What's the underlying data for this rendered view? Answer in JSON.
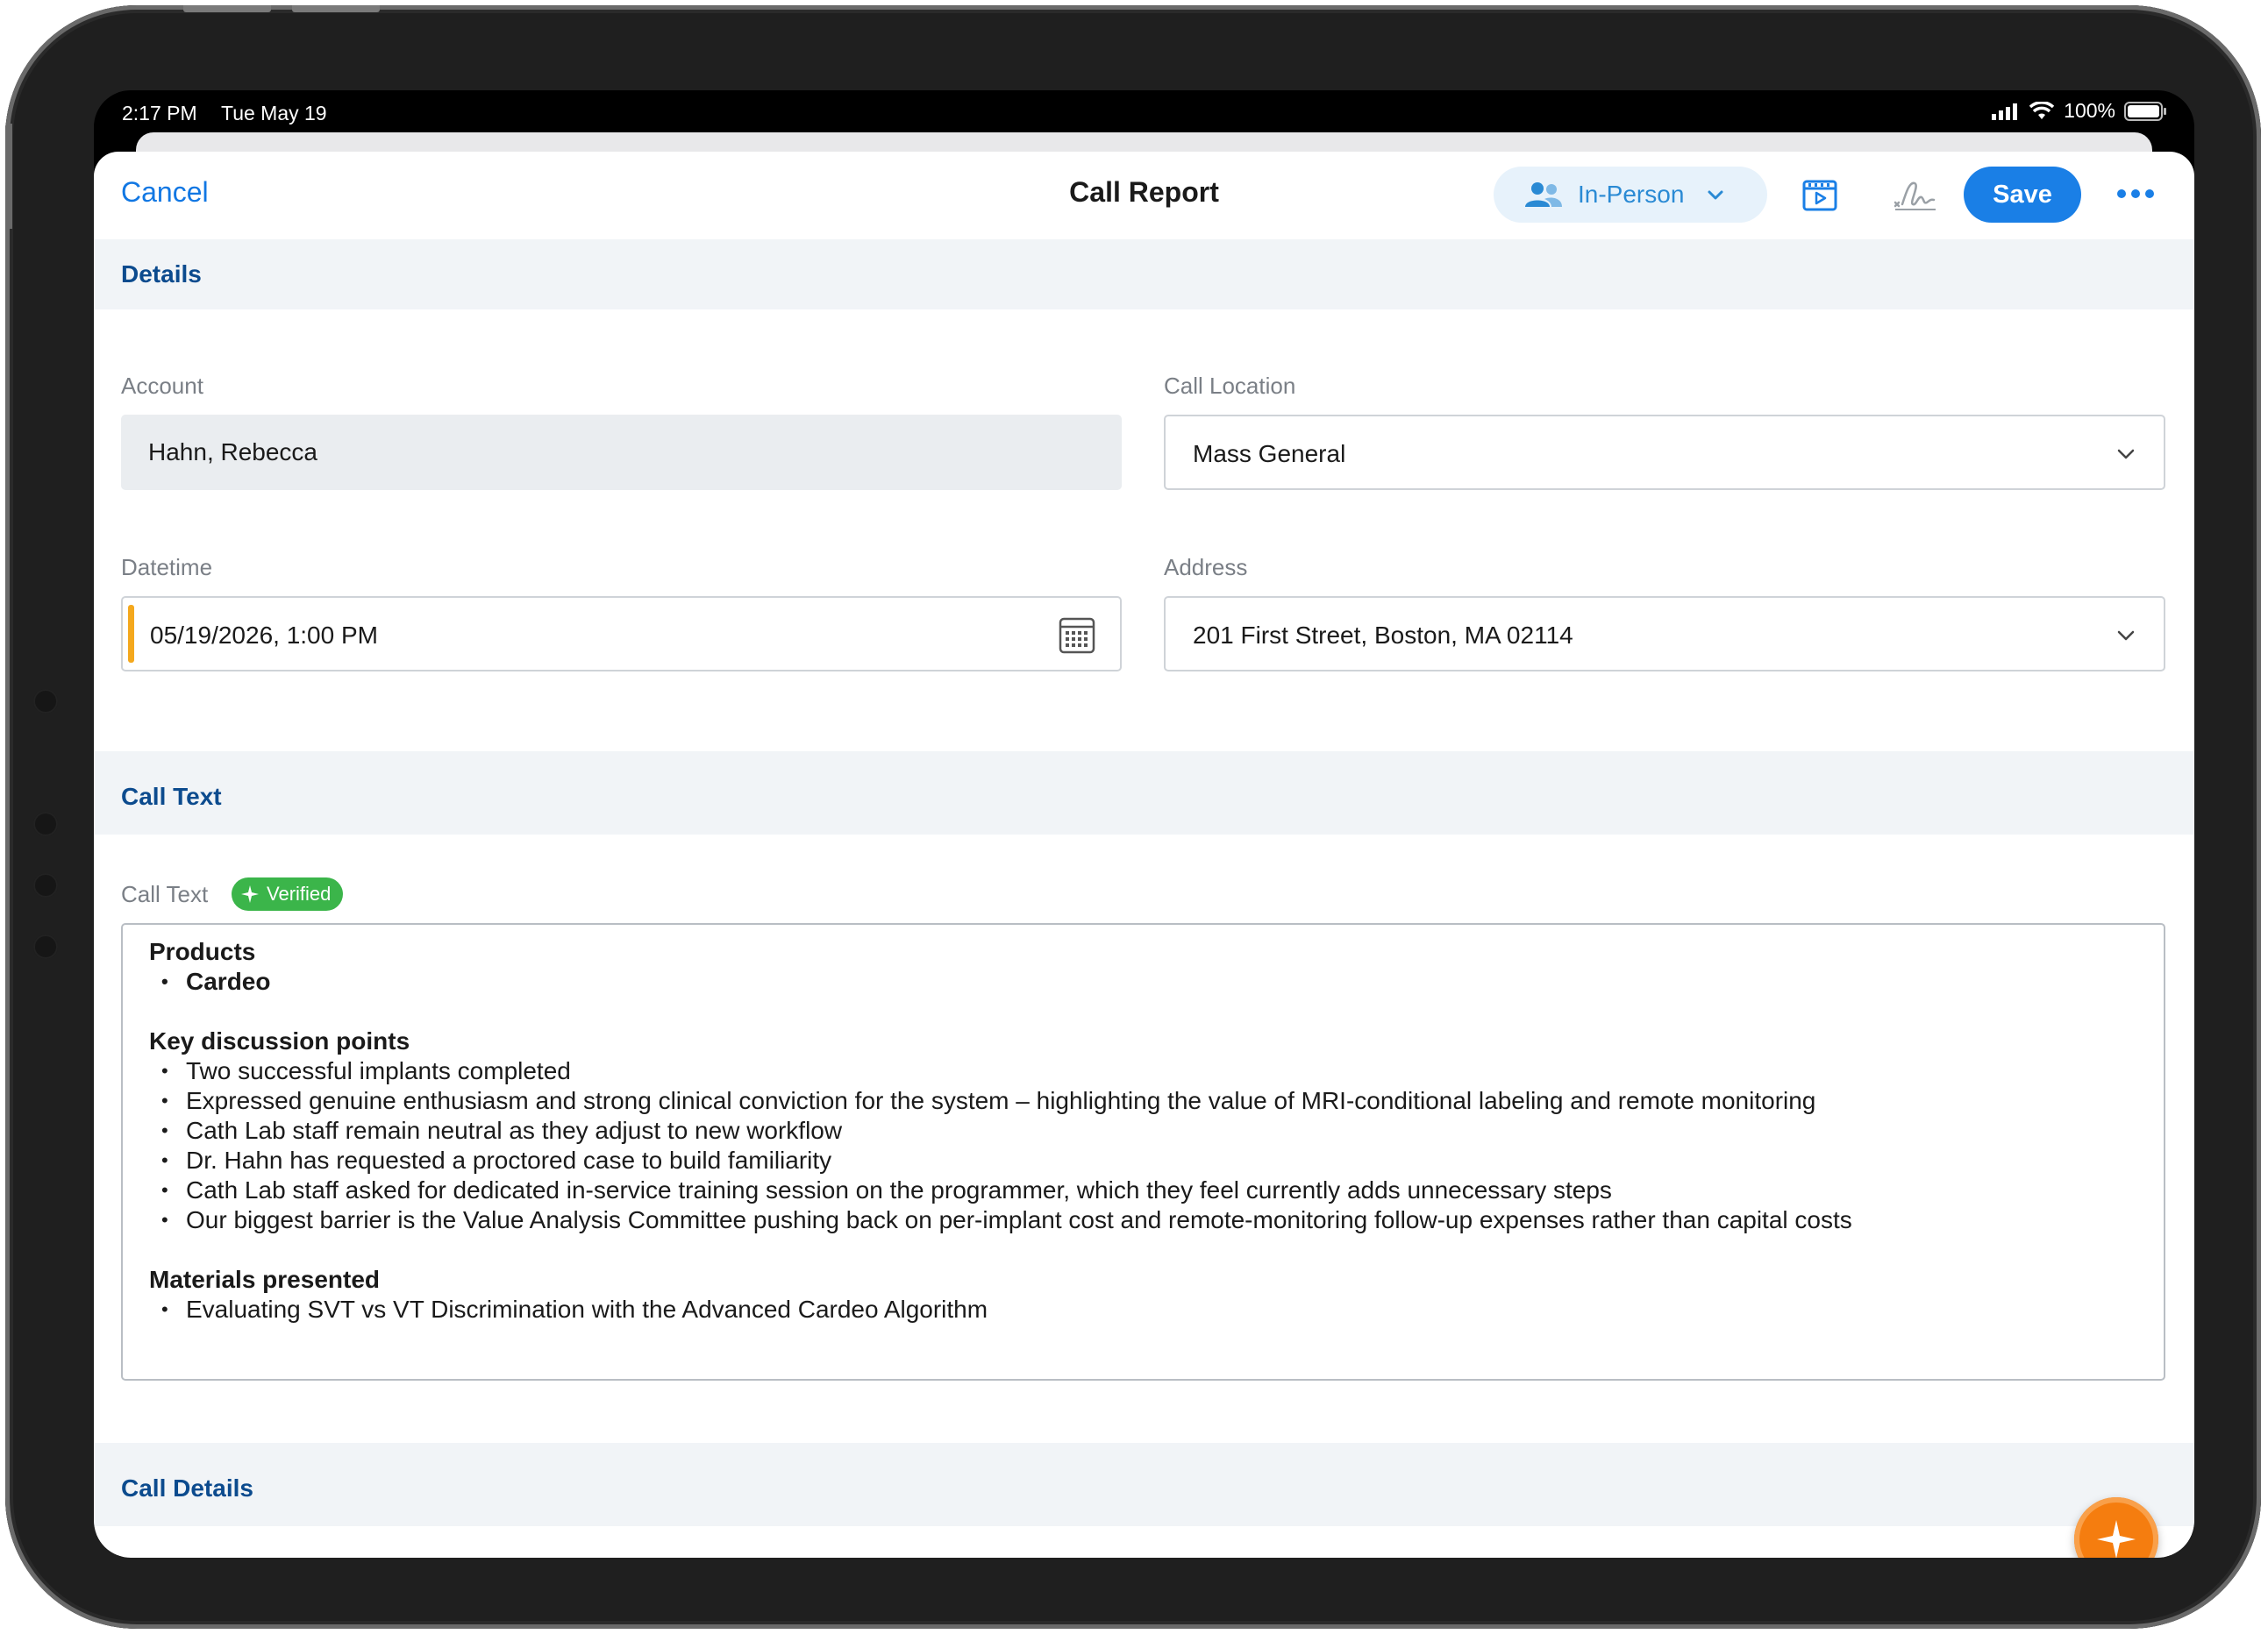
{
  "status_bar": {
    "time": "2:17 PM",
    "date": "Tue May 19",
    "battery": "100%"
  },
  "nav": {
    "cancel_label": "Cancel",
    "title": "Call Report",
    "channel_label": "In-Person",
    "save_label": "Save"
  },
  "sections": {
    "details": "Details",
    "call_text": "Call Text",
    "call_details": "Call Details"
  },
  "fields": {
    "account": {
      "label": "Account",
      "value": "Hahn, Rebecca"
    },
    "call_location": {
      "label": "Call Location",
      "value": "Mass General"
    },
    "datetime": {
      "label": "Datetime",
      "value": "05/19/2026, 1:00 PM"
    },
    "address": {
      "label": "Address",
      "value": "201 First Street, Boston, MA 02114"
    }
  },
  "call_text": {
    "label": "Call Text",
    "badge": "Verified",
    "products_heading": "Products",
    "products": [
      "Cardeo"
    ],
    "key_points_heading": "Key discussion points",
    "key_points": [
      "Two successful implants completed",
      "Expressed genuine enthusiasm and strong clinical conviction for the system – highlighting the value of MRI-conditional labeling and remote monitoring",
      "Cath Lab staff remain neutral as they adjust to new workflow",
      "Dr. Hahn has requested a proctored case to build familiarity",
      "Cath Lab staff asked for dedicated in-service training session on the programmer, which they feel currently adds unnecessary steps",
      "Our biggest barrier is the Value Analysis Committee pushing back on per-implant cost and remote-monitoring follow-up expenses rather than capital costs"
    ],
    "materials_heading": "Materials presented",
    "materials": [
      "Evaluating SVT vs VT Discrimination with the Advanced Cardeo Algorithm"
    ]
  },
  "icons": {
    "channel": "people-icon",
    "media": "media-slides-icon",
    "signature": "signature-icon",
    "more": "more-dots-icon",
    "calendar": "calendar-icon",
    "dropdown": "chevron-down-icon",
    "badge": "sparkle-icon",
    "assistant": "sparkle-fab-icon"
  },
  "colors": {
    "accent": "#1a7fe6",
    "section_title": "#0c4b8e",
    "verified": "#3bb54a",
    "fab": "#f57d0f",
    "required_marker": "#f4a81d"
  }
}
